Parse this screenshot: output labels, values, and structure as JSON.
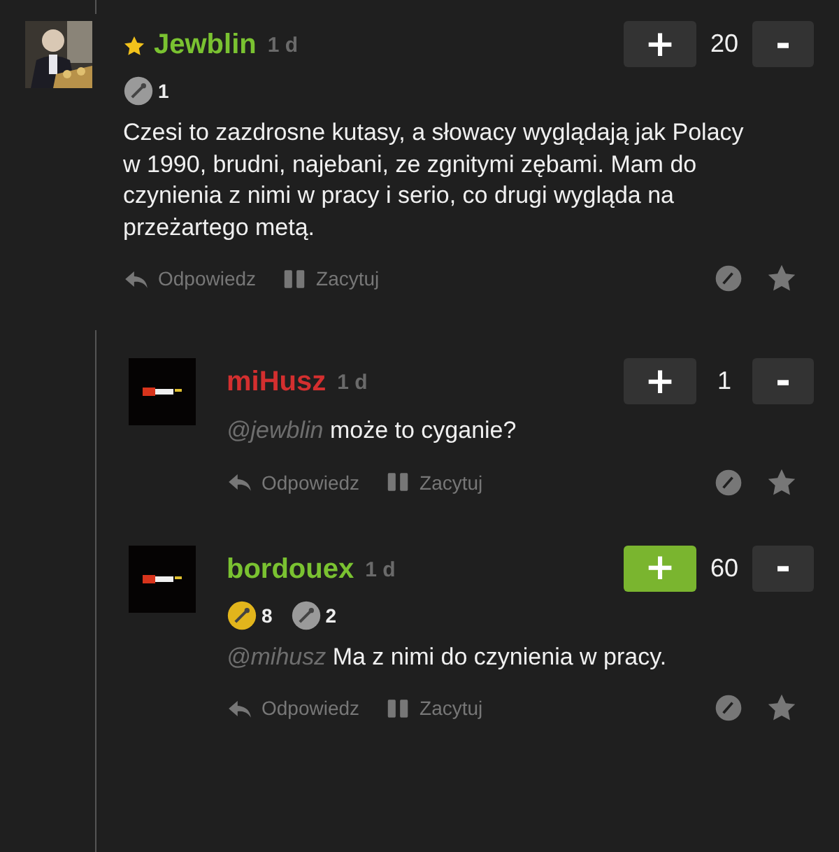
{
  "comments": [
    {
      "author": "Jewblin",
      "starred": true,
      "color": "#7ac231",
      "time": "1 d",
      "votes": {
        "plus": "+",
        "count": "20",
        "minus": "-",
        "upvoted": false
      },
      "badges": [
        {
          "kind": "silver",
          "count": "1"
        }
      ],
      "text": "Czesi to zazdrosne kutasy, a słowacy wyglądają jak Polacy w 1990, brudni, najebani, ze zgnitymi zębami. Mam do czynienia z nimi w pracy i serio, co drugi wygląda na przeżartego metą.",
      "actions": [
        "Odpowiedz",
        "Zacytuj"
      ],
      "replies": [
        {
          "author": "miHusz",
          "starred": false,
          "color": "#d32f2f",
          "time": "1 d",
          "votes": {
            "plus": "+",
            "count": "1",
            "minus": "-",
            "upvoted": false
          },
          "mention": "@jewblin",
          "text": "może to cyganie?",
          "actions": [
            "Odpowiedz",
            "Zacytuj"
          ]
        },
        {
          "author": "bordouex",
          "starred": false,
          "color": "#7ac231",
          "time": "1 d",
          "votes": {
            "plus": "+",
            "count": "60",
            "minus": "-",
            "upvoted": true
          },
          "badges": [
            {
              "kind": "gold",
              "count": "8"
            },
            {
              "kind": "silver",
              "count": "2"
            }
          ],
          "mention": "@mihusz",
          "text": "Ma z nimi do czynienia w pracy.",
          "actions": [
            "Odpowiedz",
            "Zacytuj"
          ]
        }
      ]
    }
  ]
}
